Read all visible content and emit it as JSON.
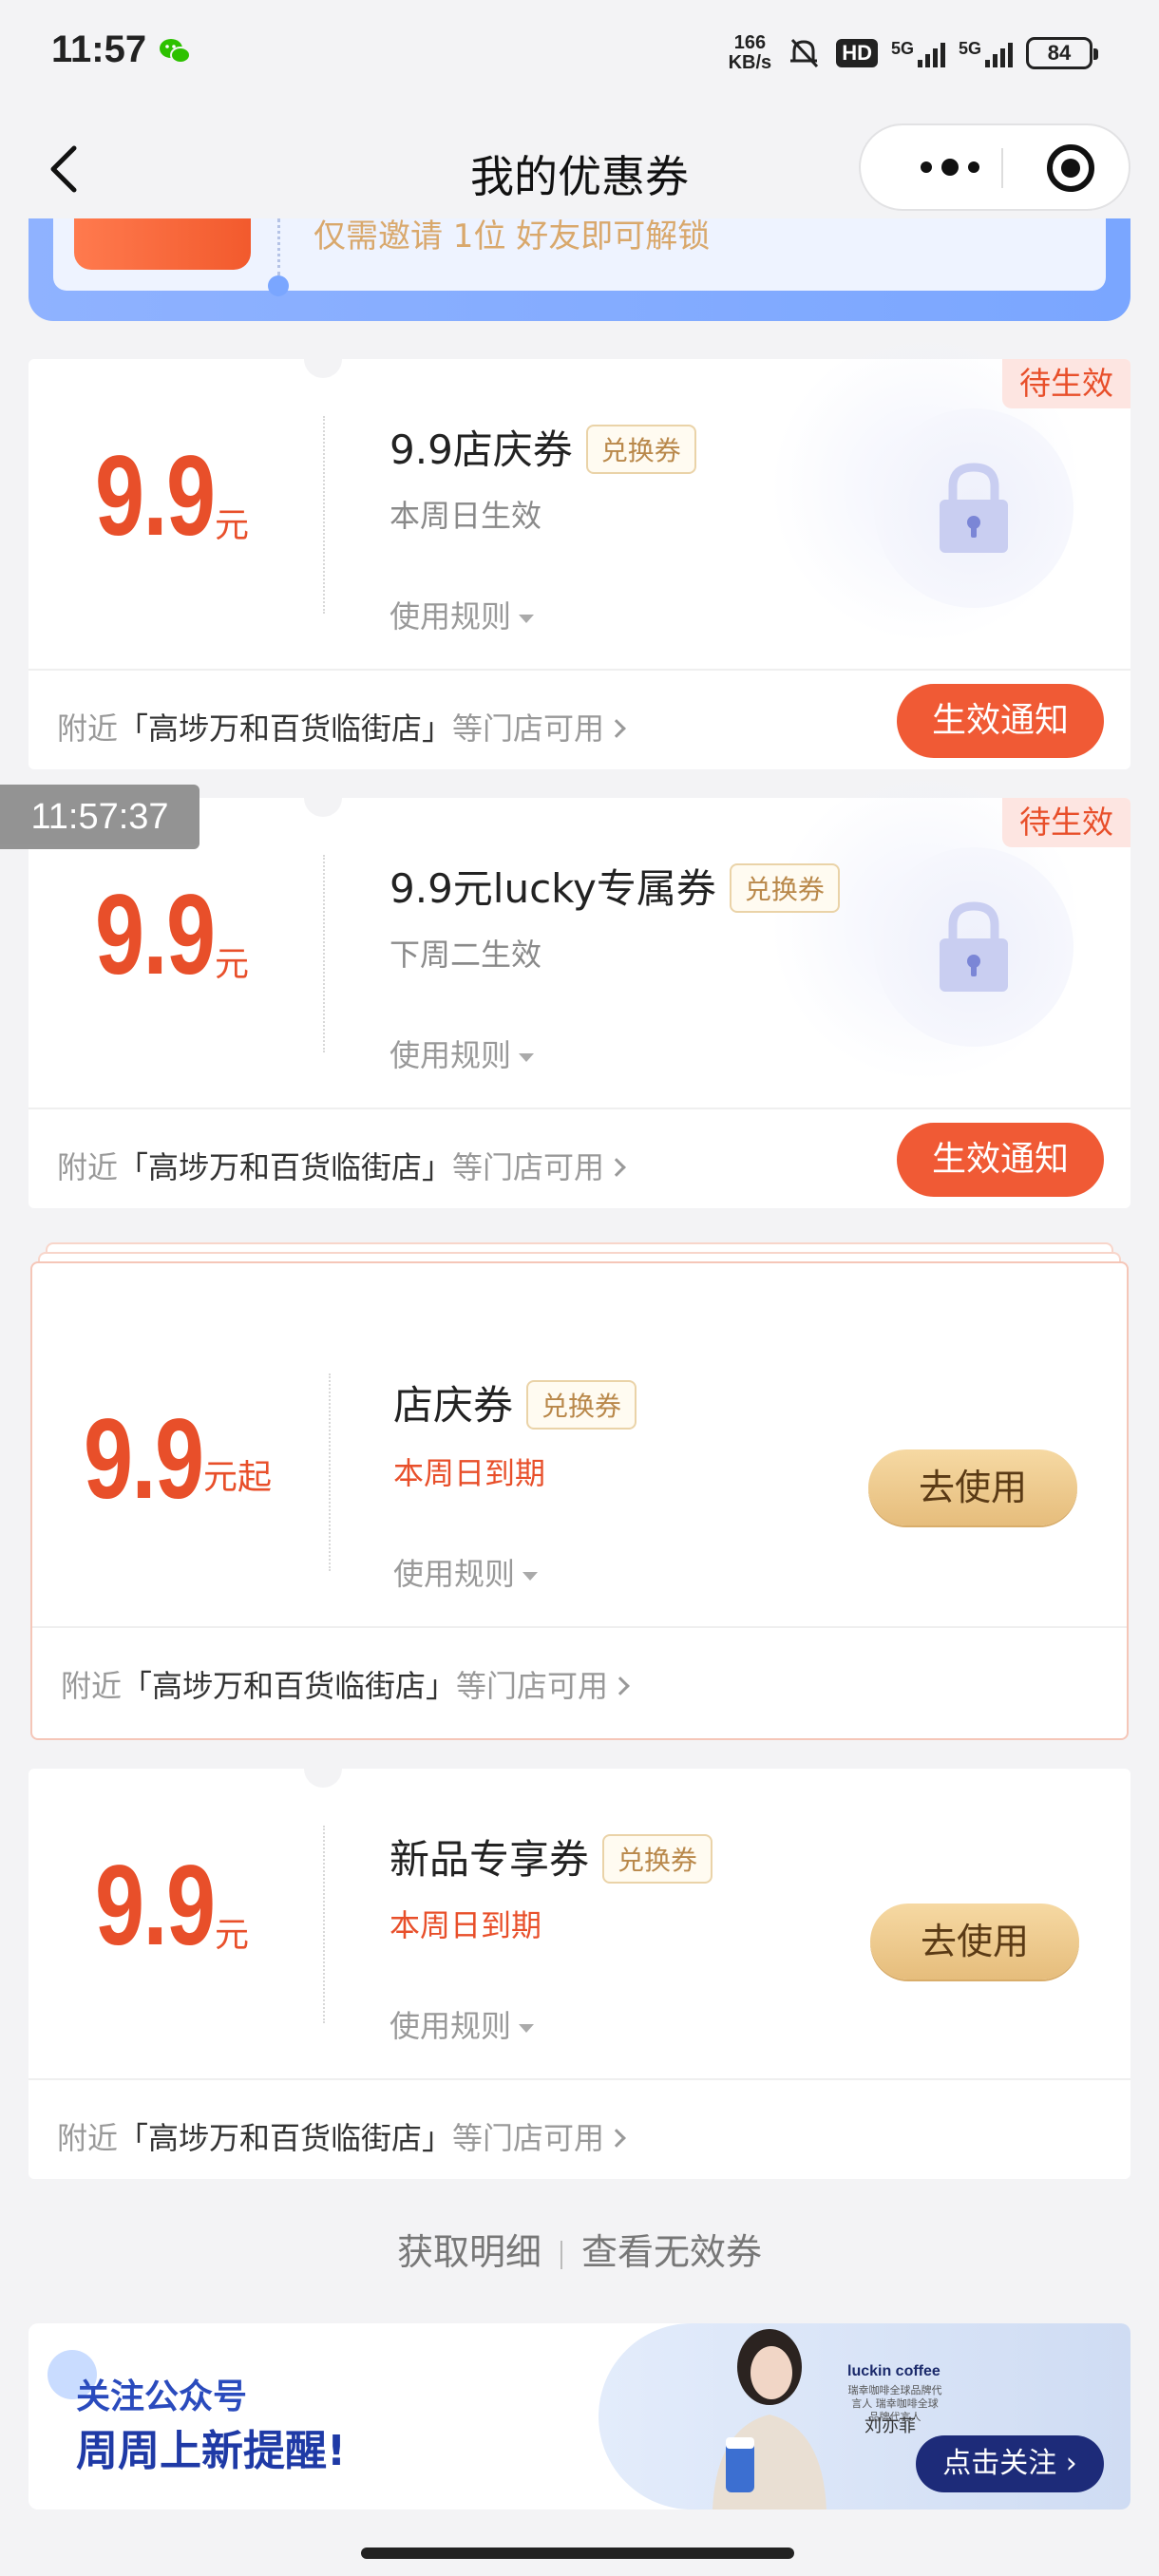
{
  "status_bar": {
    "time": "11:57",
    "speed_value": "166",
    "speed_unit": "KB/s",
    "hd": "HD",
    "sim1": "5G",
    "sim2": "5G",
    "battery": "84"
  },
  "nav": {
    "title": "我的优惠券"
  },
  "top_banner": {
    "text": "仅需邀请 1位 好友即可解锁"
  },
  "time_overlay": "11:57:37",
  "coupons": [
    {
      "price": "9.9",
      "unit": "元",
      "name": "9.9店庆券",
      "tag": "兑换券",
      "date": "本周日生效",
      "rule": "使用规则",
      "status_badge": "待生效",
      "store_prefix": "附近",
      "store_name": "「高埗万和百货临街店」",
      "store_suffix": "等门店可用",
      "button": "生效通知"
    },
    {
      "price": "9.9",
      "unit": "元",
      "name": "9.9元lucky专属券",
      "tag": "兑换券",
      "date": "下周二生效",
      "rule": "使用规则",
      "status_badge": "待生效",
      "store_prefix": "附近",
      "store_name": "「高埗万和百货临街店」",
      "store_suffix": "等门店可用",
      "button": "生效通知"
    },
    {
      "price": "9.9",
      "unit": "元起",
      "name": "店庆券",
      "tag": "兑换券",
      "date": "本周日到期",
      "rule": "使用规则",
      "store_prefix": "附近",
      "store_name": "「高埗万和百货临街店」",
      "store_suffix": "等门店可用",
      "button": "去使用"
    },
    {
      "price": "9.9",
      "unit": "元",
      "name": "新品专享券",
      "tag": "兑换券",
      "date": "本周日到期",
      "rule": "使用规则",
      "store_prefix": "附近",
      "store_name": "「高埗万和百货临街店」",
      "store_suffix": "等门店可用",
      "button": "去使用"
    }
  ],
  "links": {
    "details": "获取明细",
    "invalid": "查看无效券"
  },
  "bottom_banner": {
    "line1": "关注公众号",
    "line2": "周周上新提醒!",
    "brand": "luckin coffee",
    "brand_sub": "瑞幸咖啡全球品牌代言人 瑞幸咖啡全球品牌代言人",
    "brand_name": "刘亦菲",
    "button": "点击关注"
  },
  "colors": {
    "accent": "#e84f2a",
    "notify_button": "#f05a35",
    "use_button": "#e6bd7c",
    "banner_blue": "#1d2b79"
  }
}
